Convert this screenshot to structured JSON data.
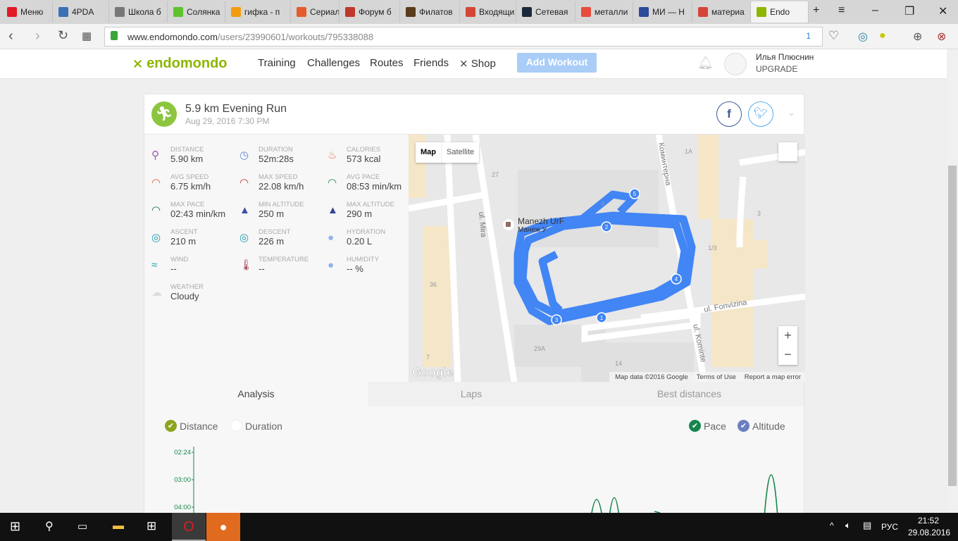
{
  "browser": {
    "tabs": [
      {
        "label": "Меню",
        "color": "#e01b24"
      },
      {
        "label": "4PDA",
        "color": "#3b6fb6"
      },
      {
        "label": "Школа б",
        "color": "#777"
      },
      {
        "label": "Солянка",
        "color": "#5ec22d"
      },
      {
        "label": "гифка - п",
        "color": "#f39c12"
      },
      {
        "label": "Сериал",
        "color": "#e55b2d"
      },
      {
        "label": "Форум б",
        "color": "#c0392b"
      },
      {
        "label": "Филатов",
        "color": "#5a3b1c"
      },
      {
        "label": "Входящи",
        "color": "#d44638"
      },
      {
        "label": "Сетевая",
        "color": "#1b2a3a"
      },
      {
        "label": "металли",
        "color": "#e74c3c"
      },
      {
        "label": "МИ — Н",
        "color": "#2c4a9a"
      },
      {
        "label": "материа",
        "color": "#d44638"
      },
      {
        "label": "Endo",
        "color": "#8db600"
      }
    ],
    "url_domain": "www.endomondo.com",
    "url_path": "/users/23990601/workouts/795338088",
    "badge_count": "1"
  },
  "header": {
    "logo": "endomondo",
    "nav": [
      "Training",
      "Challenges",
      "Routes",
      "Friends",
      "Shop"
    ],
    "add_workout": "Add Workout",
    "user_name": "Илья Плюснин",
    "upgrade": "UPGRADE"
  },
  "workout": {
    "title": "5.9 km Evening Run",
    "date": "Aug 29, 2016 7:30 PM",
    "stats": [
      {
        "label": "DISTANCE",
        "value": "5.90 km",
        "icon": "pin-icon",
        "color": "#9b59b6"
      },
      {
        "label": "DURATION",
        "value": "52m:28s",
        "icon": "stopwatch-icon",
        "color": "#6b8fd6"
      },
      {
        "label": "CALORIES",
        "value": "573 kcal",
        "icon": "flame-icon",
        "color": "#ee6e46"
      },
      {
        "label": "AVG SPEED",
        "value": "6.75 km/h",
        "icon": "speedometer-icon",
        "color": "#e0603a"
      },
      {
        "label": "MAX SPEED",
        "value": "22.08 km/h",
        "icon": "speedometer-icon",
        "color": "#c0392b"
      },
      {
        "label": "AVG PACE",
        "value": "08:53 min/km",
        "icon": "gauge-icon",
        "color": "#1e8a4c"
      },
      {
        "label": "MAX PACE",
        "value": "02:43 min/km",
        "icon": "gauge-icon",
        "color": "#16734a"
      },
      {
        "label": "MIN ALTITUDE",
        "value": "250 m",
        "icon": "mountain-icon",
        "color": "#3f51a8"
      },
      {
        "label": "MAX ALTITUDE",
        "value": "290 m",
        "icon": "mountain-icon",
        "color": "#34479a"
      },
      {
        "label": "ASCENT",
        "value": "210 m",
        "icon": "compass-icon",
        "color": "#1c9bb0"
      },
      {
        "label": "DESCENT",
        "value": "226 m",
        "icon": "compass-icon",
        "color": "#1c9bb0"
      },
      {
        "label": "HYDRATION",
        "value": "0.20 L",
        "icon": "drops-icon",
        "color": "#8fb3ee"
      },
      {
        "label": "WIND",
        "value": "--",
        "icon": "wind-icon",
        "color": "#1c9bb0"
      },
      {
        "label": "TEMPERATURE",
        "value": "--",
        "icon": "thermometer-icon",
        "color": "#a3354a"
      },
      {
        "label": "HUMIDITY",
        "value": "-- %",
        "icon": "humidity-icon",
        "color": "#8fb3ee"
      },
      {
        "label": "WEATHER",
        "value": "Cloudy",
        "icon": "cloud-icon",
        "color": "#ddd"
      }
    ]
  },
  "map": {
    "type_map": "Map",
    "type_satellite": "Satellite",
    "place": "Manezh UrF",
    "place_ru": "Манеж У",
    "streets": [
      "ul. Mira",
      "Коминтерна",
      "ul. Fonvizina",
      "ul. Kominte"
    ],
    "buildings": [
      "27",
      "4",
      "1A",
      "3",
      "1/3",
      "36",
      "29A",
      "14",
      "7"
    ],
    "markers": [
      "1",
      "2",
      "3",
      "4",
      "5"
    ],
    "zoom_in": "+",
    "zoom_out": "−",
    "attribution": "Map data ©2016 Google",
    "terms": "Terms of Use",
    "report": "Report a map error",
    "google": "Google"
  },
  "analysis": {
    "tabs": [
      "Analysis",
      "Laps",
      "Best distances"
    ],
    "x_options": [
      {
        "label": "Distance",
        "checked": true
      },
      {
        "label": "Duration",
        "checked": false
      }
    ],
    "y_options": [
      {
        "label": "Pace",
        "checked": true
      },
      {
        "label": "Altitude",
        "checked": true
      }
    ],
    "pace_ticks": [
      "02:24",
      "03:00",
      "04:00"
    ]
  },
  "taskbar": {
    "lang": "РУС",
    "time": "21:52",
    "date": "29.08.2016"
  }
}
